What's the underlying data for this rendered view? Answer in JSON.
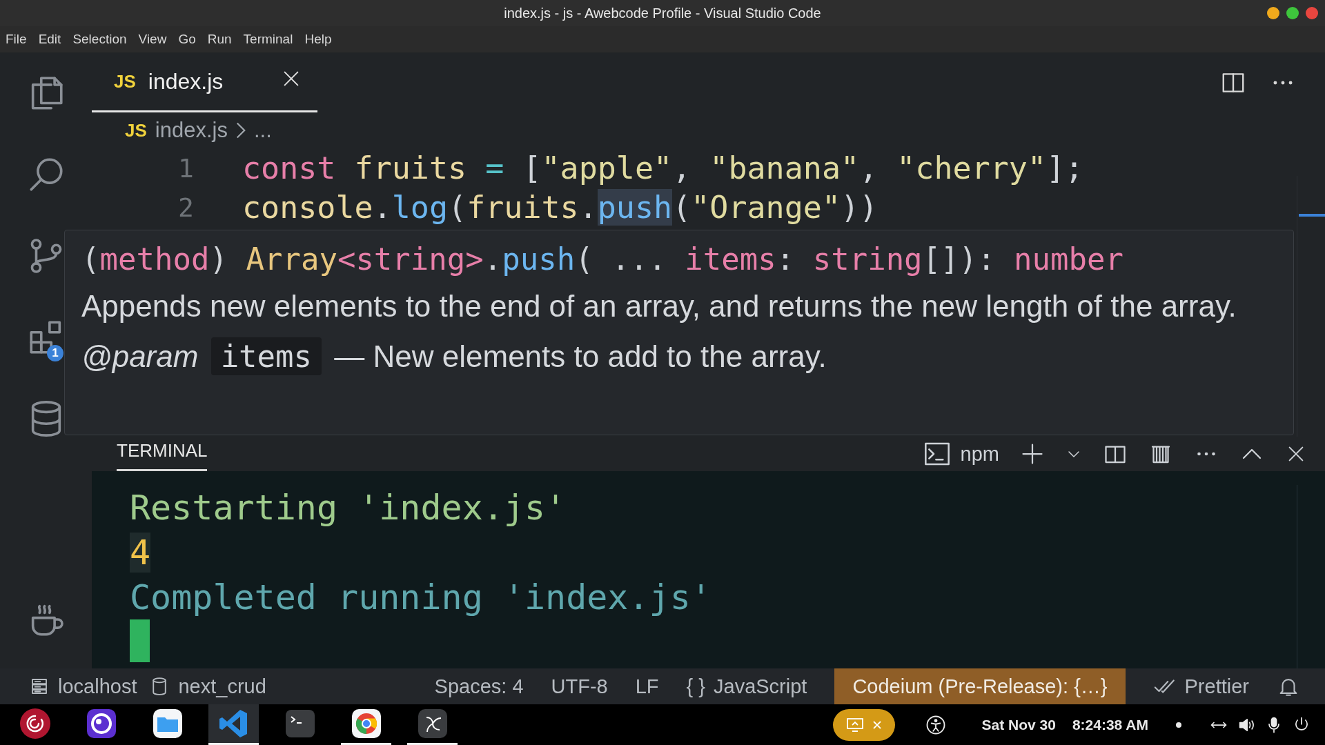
{
  "window": {
    "title": "index.js - js - Awebcode Profile - Visual Studio Code"
  },
  "menu": [
    "File",
    "Edit",
    "Selection",
    "View",
    "Go",
    "Run",
    "Terminal",
    "Help"
  ],
  "activity_bar": {
    "extensions_badge": "1"
  },
  "tabs": [
    {
      "icon_text": "JS",
      "label": "index.js",
      "selected": true
    }
  ],
  "breadcrumb": {
    "icon_text": "JS",
    "file": "index.js",
    "rest": "..."
  },
  "editor": {
    "lines": [
      {
        "number": "1",
        "tokens": [
          {
            "kind": "keyword",
            "text": "const"
          },
          {
            "kind": "variable",
            "text": " fruits "
          },
          {
            "kind": "operator",
            "text": "="
          },
          {
            "kind": "punct",
            "text": " ["
          },
          {
            "kind": "string",
            "text": "\"apple\""
          },
          {
            "kind": "punct",
            "text": ", "
          },
          {
            "kind": "string",
            "text": "\"banana\""
          },
          {
            "kind": "punct",
            "text": ", "
          },
          {
            "kind": "string",
            "text": "\"cherry\""
          },
          {
            "kind": "punct",
            "text": "];"
          }
        ]
      },
      {
        "number": "2",
        "tokens": [
          {
            "kind": "variable",
            "text": "console"
          },
          {
            "kind": "punct",
            "text": "."
          },
          {
            "kind": "function",
            "text": "log"
          },
          {
            "kind": "punct",
            "text": "("
          },
          {
            "kind": "variable",
            "text": "fruits"
          },
          {
            "kind": "punct",
            "text": "."
          },
          {
            "kind": "hovered",
            "text": "push"
          },
          {
            "kind": "punct",
            "text": "("
          },
          {
            "kind": "string",
            "text": "\"Orange\""
          },
          {
            "kind": "punct",
            "text": "))"
          }
        ]
      }
    ]
  },
  "hover": {
    "signature": [
      {
        "kind": "punct",
        "text": "("
      },
      {
        "kind": "keyword",
        "text": "method"
      },
      {
        "kind": "punct",
        "text": ") "
      },
      {
        "kind": "type",
        "text": "Array"
      },
      {
        "kind": "keyword",
        "text": "<string>"
      },
      {
        "kind": "punct",
        "text": "."
      },
      {
        "kind": "function",
        "text": "push"
      },
      {
        "kind": "punct",
        "text": "( ... "
      },
      {
        "kind": "keyword",
        "text": "items"
      },
      {
        "kind": "punct",
        "text": ": "
      },
      {
        "kind": "keyword",
        "text": "string"
      },
      {
        "kind": "punct",
        "text": "[]): "
      },
      {
        "kind": "keyword",
        "text": "number"
      }
    ],
    "description": "Appends new elements to the end of an array, and returns the new length of the array.",
    "param_tag": "@param",
    "param_name": "items",
    "param_text": "— New elements to add to the array."
  },
  "panel": {
    "tabs": [
      {
        "label": "TERMINAL",
        "selected": true
      }
    ],
    "shell": "npm",
    "lines": [
      {
        "kind": "info",
        "text": "Restarting 'index.js'"
      },
      {
        "kind": "output",
        "text": "4"
      },
      {
        "kind": "done",
        "text": "Completed running 'index.js'"
      }
    ]
  },
  "status_bar": {
    "left": [
      {
        "kind": "server",
        "text": "localhost"
      },
      {
        "kind": "database",
        "text": "next_crud"
      }
    ],
    "right": [
      {
        "kind": "plain",
        "text": "Spaces: 4"
      },
      {
        "kind": "plain",
        "text": "UTF-8"
      },
      {
        "kind": "plain",
        "text": "LF"
      },
      {
        "kind": "braces",
        "icon_text": "{ }",
        "text": "JavaScript"
      },
      {
        "kind": "highlight",
        "text": "Codeium (Pre-Release): {…}"
      },
      {
        "kind": "check",
        "text": "Prettier"
      },
      {
        "kind": "bell"
      }
    ]
  },
  "taskbar": {
    "apps": [
      {
        "kind": "debian",
        "selected": false,
        "running": false
      },
      {
        "kind": "purple",
        "selected": false,
        "running": false
      },
      {
        "kind": "files",
        "selected": false,
        "running": false
      },
      {
        "kind": "vscode",
        "selected": true,
        "running": true
      },
      {
        "kind": "terminal",
        "selected": false,
        "running": false
      },
      {
        "kind": "chrome",
        "selected": false,
        "running": true
      },
      {
        "kind": "obs",
        "selected": false,
        "running": true
      }
    ],
    "date": "Sat Nov 30",
    "time": "8:24:38 AM"
  }
}
